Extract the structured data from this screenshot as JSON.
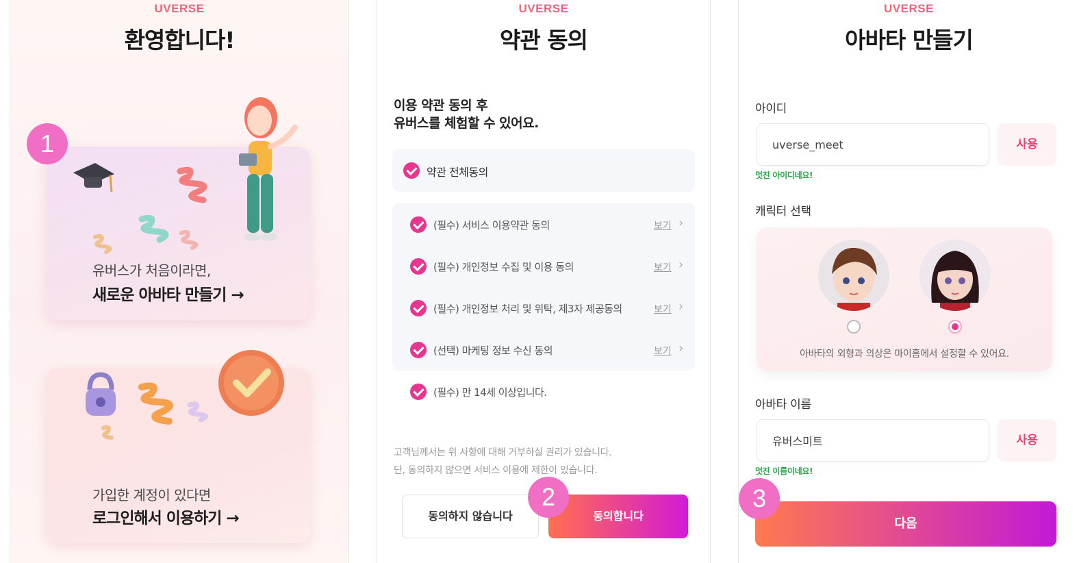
{
  "screen1": {
    "brand": "UVERSE",
    "title": "환영합니다!",
    "step_number": "1",
    "new_card": {
      "subtitle": "유버스가 처음이라면,",
      "action": "새로운 아바타 만들기 →"
    },
    "login_card": {
      "subtitle": "가입한 계정이 있다면",
      "action": "로그인해서 이용하기 →"
    }
  },
  "screen2": {
    "brand": "UVERSE",
    "title": "약관 동의",
    "intro_line1": "이용 약관 동의 후",
    "intro_line2": "유버스를 체험할 수 있어요.",
    "agree_all_label": "약관 전체동의",
    "view_label": "보기",
    "terms": [
      {
        "label": "(필수) 서비스 이용약관 동의"
      },
      {
        "label": "(필수) 개인정보 수집 및 이용 동의"
      },
      {
        "label": "(필수) 개인정보 처리 및 위탁, 제3자 제공동의"
      },
      {
        "label": "(선택) 마케팅 정보 수신 동의"
      }
    ],
    "age_label": "(필수) 만 14세 이상입니다.",
    "notice_line1": "고객님께서는 위 사항에 대해 거부하실 권리가 있습니다.",
    "notice_line2": "단, 동의하지 않으면 서비스 이용에 제한이 있습니다.",
    "decline_button": "동의하지 않습니다",
    "agree_button": "동의합니다",
    "step_number": "2"
  },
  "screen3": {
    "brand": "UVERSE",
    "title": "아바타 만들기",
    "id_label": "아이디",
    "id_value": "uverse_meet",
    "use_button": "사용",
    "id_valid": "멋진 아이디네요!",
    "character_label": "캐릭터 선택",
    "selected_character": 2,
    "character_note": "아바타의 외형과 의상은 마이홈에서 설정할 수 있어요.",
    "name_label": "아바타 이름",
    "name_value": "유버스미트",
    "name_valid": "멋진 이름이네요!",
    "next_button": "다음",
    "step_number": "3"
  },
  "colors": {
    "accent_pink": "#e8358f",
    "badge_pink": "#f06ec4",
    "gradient_start": "#ff7a4f",
    "gradient_end": "#c219d8",
    "valid_green": "#2aa84a"
  }
}
